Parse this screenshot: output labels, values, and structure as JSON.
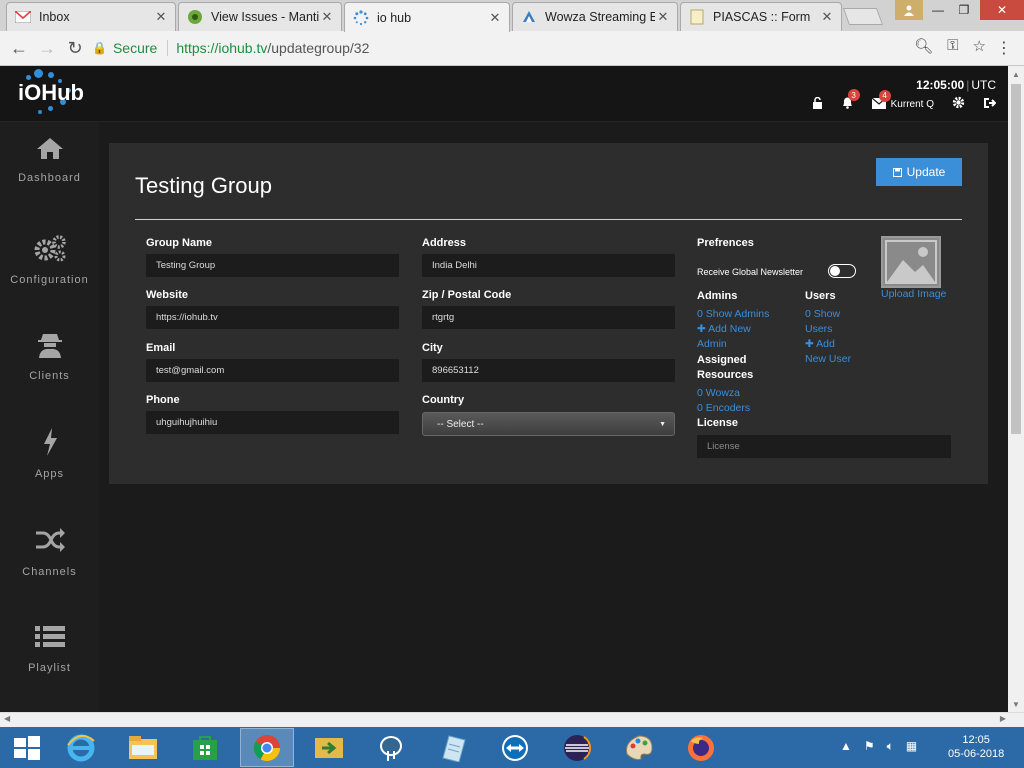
{
  "browser": {
    "tabs": [
      {
        "title": "Inbox",
        "icon": "gmail-icon"
      },
      {
        "title": "View Issues - Mantis",
        "icon": "mantis-icon"
      },
      {
        "title": "io hub",
        "icon": "spinner-icon"
      },
      {
        "title": "Wowza Streaming E",
        "icon": "wowza-icon"
      },
      {
        "title": "PIASCAS :: Form",
        "icon": "page-icon"
      }
    ],
    "address": {
      "secure_label": "Secure",
      "url_host": "https://iohub.tv",
      "url_path": "/updategroup/32"
    }
  },
  "header": {
    "logo_text": "iOHub",
    "time": "12:05:00",
    "timezone": "UTC",
    "notifications_count": "3",
    "messages_count": "4",
    "username": "Kurrent Q"
  },
  "sidebar": {
    "items": [
      {
        "label": "Dashboard",
        "icon": "home-icon"
      },
      {
        "label": "Configuration",
        "icon": "gears-icon"
      },
      {
        "label": "Clients",
        "icon": "user-secret-icon"
      },
      {
        "label": "Apps",
        "icon": "bolt-icon"
      },
      {
        "label": "Channels",
        "icon": "shuffle-icon"
      },
      {
        "label": "Playlist",
        "icon": "list-icon"
      }
    ]
  },
  "form": {
    "title": "Testing Group",
    "update_label": "Update",
    "group_name": {
      "label": "Group Name",
      "value": "Testing Group"
    },
    "website": {
      "label": "Website",
      "value": "https://iohub.tv"
    },
    "email": {
      "label": "Email",
      "value": "test@gmail.com"
    },
    "phone": {
      "label": "Phone",
      "value": "uhguihujhuihiu"
    },
    "address": {
      "label": "Address",
      "value": "India Delhi"
    },
    "zip": {
      "label": "Zip / Postal Code",
      "value": "rtgrtg"
    },
    "city": {
      "label": "City",
      "value": "896653112"
    },
    "country": {
      "label": "Country",
      "value": "-- Select --"
    }
  },
  "preferences": {
    "heading": "Prefrences",
    "newsletter_label": "Receive Global Newsletter",
    "newsletter_on": false,
    "upload_label": "Upload Image",
    "admins": {
      "heading": "Admins",
      "show": "0 Show Admins",
      "add_line1": "Add New",
      "add_line2": "Admin"
    },
    "users": {
      "heading": "Users",
      "show_line1": "0 Show",
      "show_line2": "Users",
      "add_line1": "Add",
      "add_line2": "New User"
    },
    "resources": {
      "heading_line1": "Assigned",
      "heading_line2": "Resources",
      "wowza": "0 Wowza",
      "encoders": "0 Encoders"
    },
    "license": {
      "heading": "License",
      "placeholder": "License"
    }
  },
  "taskbar": {
    "time": "12:05",
    "date": "05-06-2018"
  },
  "colors": {
    "accent": "#3b8ed8",
    "badge": "#d9433a",
    "secure_green": "#1e8e3e"
  }
}
